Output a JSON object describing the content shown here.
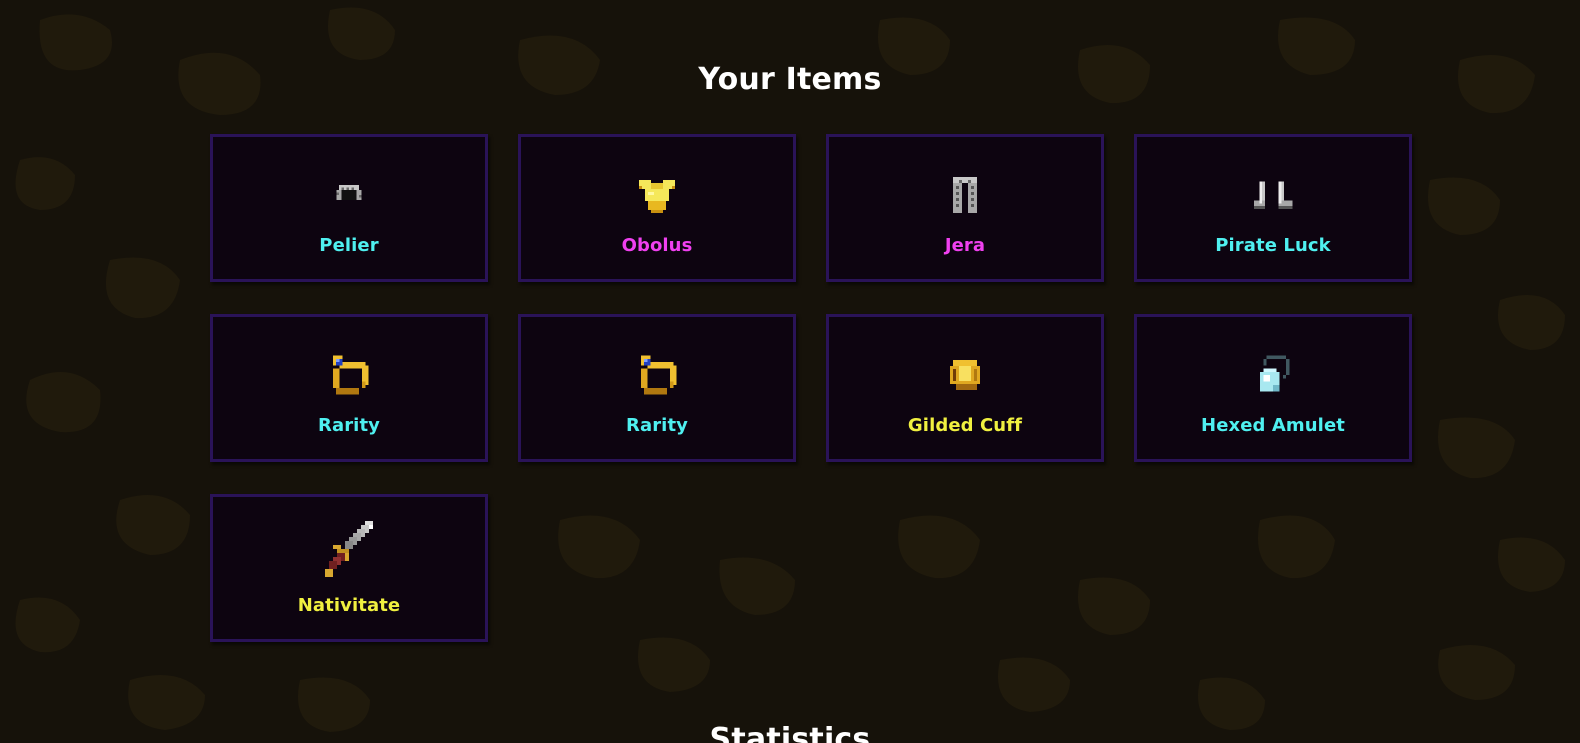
{
  "items_section": {
    "title": "Your Items",
    "items": [
      {
        "name": "Pelier",
        "color": "#4ff0f0",
        "icon": "chainmail-helmet-icon"
      },
      {
        "name": "Obolus",
        "color": "#f040f0",
        "icon": "gold-chestplate-icon"
      },
      {
        "name": "Jera",
        "color": "#f040f0",
        "icon": "chainmail-leggings-icon"
      },
      {
        "name": "Pirate Luck",
        "color": "#4ff0f0",
        "icon": "iron-boots-icon"
      },
      {
        "name": "Rarity",
        "color": "#4ff0f0",
        "icon": "sapphire-ring-icon"
      },
      {
        "name": "Rarity",
        "color": "#4ff0f0",
        "icon": "sapphire-ring-icon"
      },
      {
        "name": "Gilded Cuff",
        "color": "#f0f040",
        "icon": "gold-cuff-icon"
      },
      {
        "name": "Hexed Amulet",
        "color": "#4ff0f0",
        "icon": "pearl-amulet-icon"
      },
      {
        "name": "Nativitate",
        "color": "#f0f040",
        "icon": "sword-icon"
      }
    ]
  },
  "statistics_section": {
    "title": "Statistics"
  }
}
